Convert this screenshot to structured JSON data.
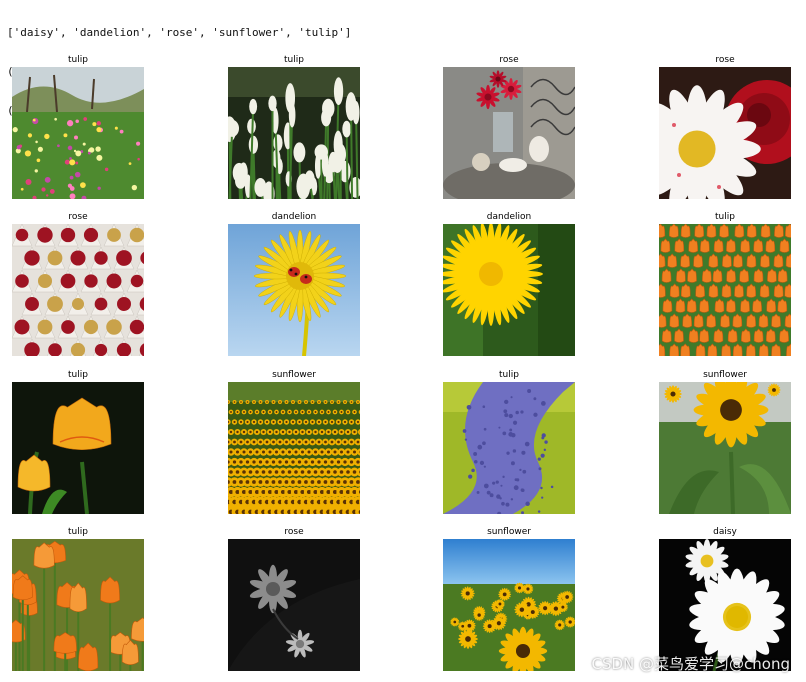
{
  "output": {
    "lines": [
      "['daisy', 'dandelion', 'rose', 'sunflower', 'tulip']",
      "(16, 150, 150, 3)",
      "(16,)"
    ]
  },
  "images": [
    {
      "label": "tulip",
      "scene": "tulip-meadow"
    },
    {
      "label": "tulip",
      "scene": "white-tulips"
    },
    {
      "label": "rose",
      "scene": "rose-table"
    },
    {
      "label": "rose",
      "scene": "daisy-and-rose"
    },
    {
      "label": "rose",
      "scene": "rose-bouquets"
    },
    {
      "label": "dandelion",
      "scene": "dandelion-sky"
    },
    {
      "label": "dandelion",
      "scene": "dandelion-green"
    },
    {
      "label": "tulip",
      "scene": "orange-tulip-field"
    },
    {
      "label": "tulip",
      "scene": "yellow-tulip-dark"
    },
    {
      "label": "sunflower",
      "scene": "sunflower-rows"
    },
    {
      "label": "tulip",
      "scene": "blue-flower-river"
    },
    {
      "label": "sunflower",
      "scene": "sunflower-closeup"
    },
    {
      "label": "tulip",
      "scene": "orange-tulips-closeup"
    },
    {
      "label": "rose",
      "scene": "grayscale-rose"
    },
    {
      "label": "sunflower",
      "scene": "sunflower-sky"
    },
    {
      "label": "daisy",
      "scene": "daisy-dark"
    }
  ],
  "watermark": "CSDN @菜鸟爱学习@chong"
}
